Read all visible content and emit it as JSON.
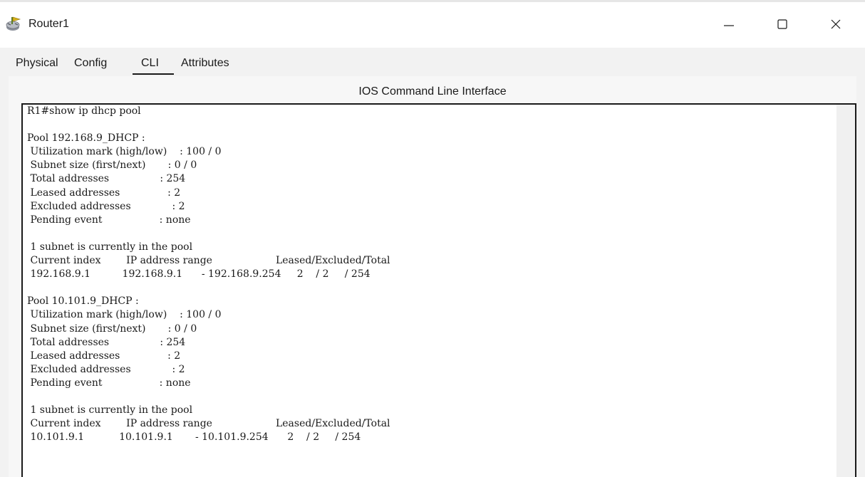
{
  "window": {
    "title": "Router1",
    "icon": "router-icon"
  },
  "window_controls": {
    "minimize_icon": "minimize-icon",
    "maximize_icon": "maximize-icon",
    "close_icon": "close-icon"
  },
  "tabs": [
    {
      "label": "Physical"
    },
    {
      "label": "Config"
    },
    {
      "label": "CLI",
      "active": true
    },
    {
      "label": "Attributes"
    }
  ],
  "panel": {
    "header": "IOS Command Line Interface"
  },
  "cli": {
    "output": "R1#show ip dhcp pool\n\nPool 192.168.9_DHCP :\n Utilization mark (high/low)    : 100 / 0\n Subnet size (first/next)       : 0 / 0\n Total addresses                : 254\n Leased addresses               : 2\n Excluded addresses             : 2\n Pending event                  : none\n\n 1 subnet is currently in the pool\n Current index        IP address range                    Leased/Excluded/Total\n 192.168.9.1          192.168.9.1      - 192.168.9.254     2    / 2     / 254\n\nPool 10.101.9_DHCP :\n Utilization mark (high/low)    : 100 / 0\n Subnet size (first/next)       : 0 / 0\n Total addresses                : 254\n Leased addresses               : 2\n Excluded addresses             : 2\n Pending event                  : none\n\n 1 subnet is currently in the pool\n Current index        IP address range                    Leased/Excluded/Total\n 10.101.9.1           10.101.9.1       - 10.101.9.254      2    / 2     / 254"
  }
}
